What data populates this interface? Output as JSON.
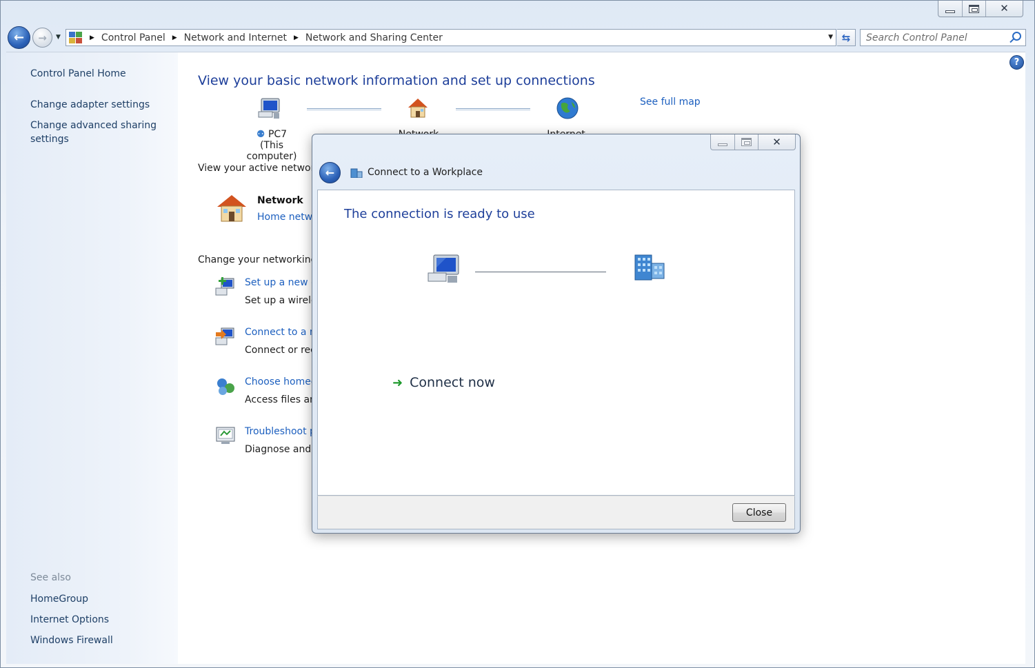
{
  "window": {
    "caption_buttons": {
      "minimize_icon": "minimize-icon",
      "maximize_icon": "maximize-icon",
      "close_icon": "close-icon"
    }
  },
  "navigation": {
    "breadcrumb": [
      "Control Panel",
      "Network and Internet",
      "Network and Sharing Center"
    ],
    "search_placeholder": "Search Control Panel"
  },
  "left_pane": {
    "home_link": "Control Panel Home",
    "tasks": [
      "Change adapter settings",
      "Change advanced sharing",
      "settings"
    ],
    "see_also_label": "See also",
    "see_also": [
      "HomeGroup",
      "Internet Options",
      "Windows Firewall"
    ]
  },
  "main": {
    "title": "View your basic network information and set up connections",
    "see_full_map": "See full map",
    "map_nodes": [
      {
        "name": "PC7",
        "sub": "(This computer)"
      },
      {
        "name": "Network"
      },
      {
        "name": "Internet"
      }
    ],
    "active_networks_label": "View your active network",
    "network": {
      "name": "Network",
      "type": "Home netw"
    },
    "change_label": "Change your networking",
    "tasks": [
      {
        "link": "Set up a new c",
        "desc": "Set up a wirele"
      },
      {
        "link": "Connect to a n",
        "desc": "Connect or rec"
      },
      {
        "link": "Choose homeg",
        "desc": "Access files an"
      },
      {
        "link": "Troubleshoot p",
        "desc": "Diagnose and"
      }
    ]
  },
  "dialog": {
    "title": "Connect to a Workplace",
    "heading": "The connection is ready to use",
    "connect_now": "Connect now",
    "close_button": "Close"
  },
  "colors": {
    "accent": "#1e3f9a",
    "link": "#1c5fbf",
    "connect_arrow": "#1f9a2e"
  }
}
